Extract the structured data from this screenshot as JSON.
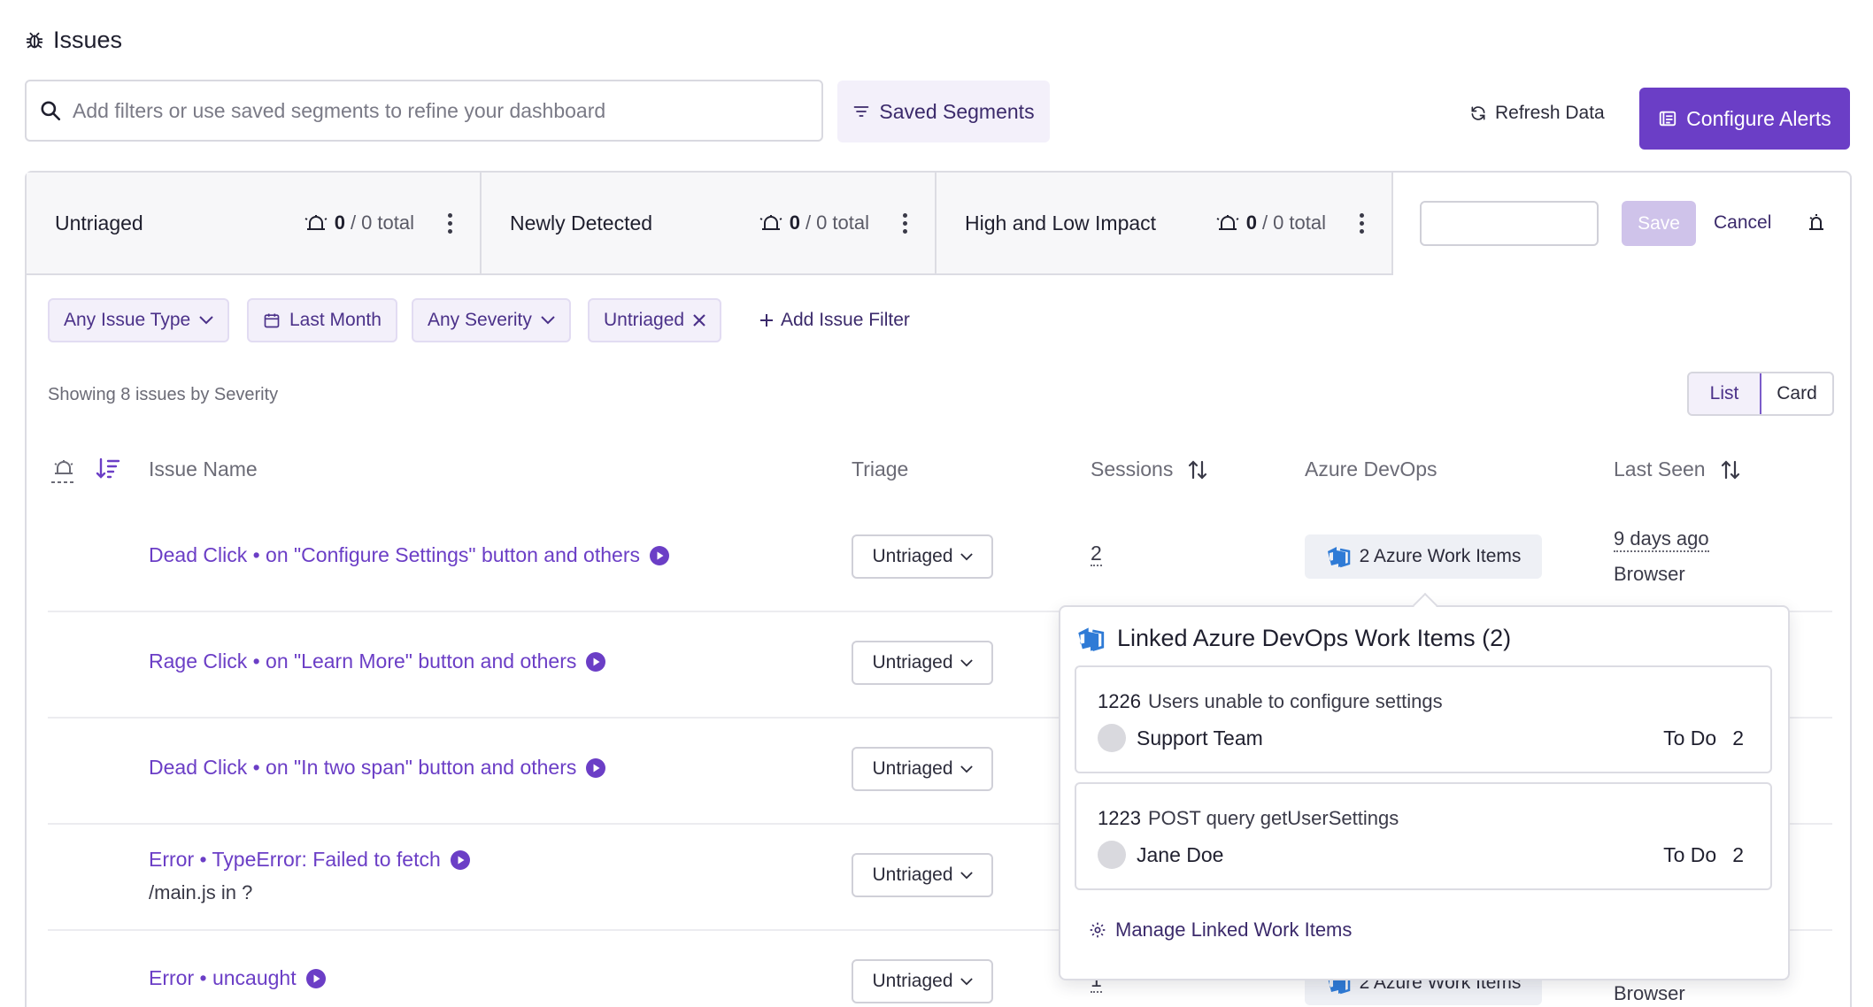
{
  "header": {
    "title": "Issues",
    "search_placeholder": "Add filters or use saved segments to refine your dashboard",
    "saved_segments_label": "Saved Segments",
    "refresh_label": "Refresh Data",
    "configure_alerts_label": "Configure Alerts"
  },
  "segments": [
    {
      "name": "Untriaged",
      "count": "0",
      "sep": "/",
      "total": "0 total"
    },
    {
      "name": "Newly Detected",
      "count": "0",
      "sep": "/",
      "total": "0 total"
    },
    {
      "name": "High and Low Impact",
      "count": "0",
      "sep": "/",
      "total": "0 total"
    }
  ],
  "segment_editor": {
    "input_value": "",
    "save_label": "Save",
    "cancel_label": "Cancel"
  },
  "filters": {
    "issue_type": "Any Issue Type",
    "date": "Last Month",
    "severity": "Any Severity",
    "status": "Untriaged",
    "add_label": "Add Issue Filter"
  },
  "summary": "Showing 8 issues by Severity",
  "view_toggle": {
    "list": "List",
    "card": "Card",
    "selected": "List"
  },
  "columns": {
    "issue_name": "Issue Name",
    "triage": "Triage",
    "sessions": "Sessions",
    "azure": "Azure DevOps",
    "last_seen": "Last Seen"
  },
  "rows": [
    {
      "name": "Dead Click • on \"Configure Settings\" button and others",
      "sub": "",
      "triage": "Untriaged",
      "sessions": "2",
      "azure": "2 Azure Work Items",
      "last_seen": "9 days ago",
      "browser": "Browser"
    },
    {
      "name": "Rage Click • on \"Learn More\" button and others",
      "sub": "",
      "triage": "Untriaged"
    },
    {
      "name": "Dead Click • on \"In two span\" button and others",
      "sub": "",
      "triage": "Untriaged"
    },
    {
      "name": "Error • TypeError: Failed to fetch",
      "sub": "/main.js in ?",
      "triage": "Untriaged"
    },
    {
      "name": "Error • uncaught",
      "sub": "",
      "triage": "Untriaged",
      "sessions": "1",
      "azure": "2 Azure Work Items",
      "browser": "Browser"
    }
  ],
  "popover": {
    "title": "Linked Azure DevOps Work Items (2)",
    "items": [
      {
        "id": "1226",
        "title": "Users unable to configure settings",
        "assignee": "Support Team",
        "status": "To Do",
        "count": "2"
      },
      {
        "id": "1223",
        "title": "POST query getUserSettings",
        "assignee": "Jane Doe",
        "status": "To Do",
        "count": "2"
      }
    ],
    "manage_label": "Manage Linked Work Items"
  },
  "colors": {
    "accent": "#6b3ec6",
    "chip_bg": "#f3f0fa",
    "azure_blue": "#2f7bd6"
  },
  "icons": [
    "bug-icon",
    "search-icon",
    "filter-icon",
    "refresh-icon",
    "alerts-icon",
    "kebab-icon",
    "calendar-icon",
    "chevron-down-icon",
    "close-icon",
    "plus-icon",
    "sort-icon",
    "play-icon",
    "azure-devops-icon",
    "gear-icon"
  ]
}
